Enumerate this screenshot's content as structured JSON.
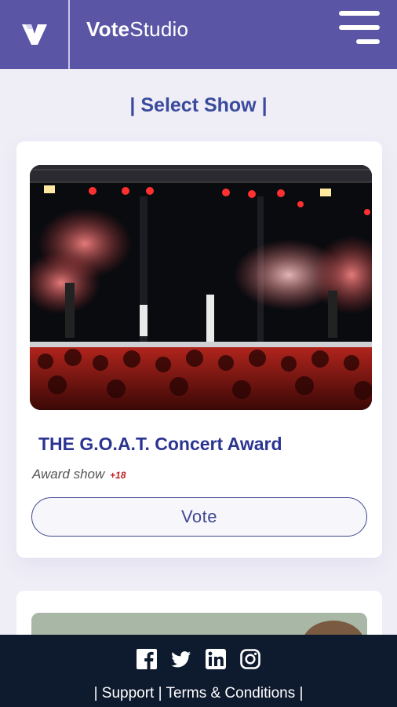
{
  "header": {
    "brand_bold": "Vote",
    "brand_regular": "Studio",
    "logo_icon": "v-logo-icon",
    "menu_icon": "hamburger-menu-icon",
    "color": "#5a56a5"
  },
  "page": {
    "section_title": "| Select Show |"
  },
  "shows": [
    {
      "title": "THE G.O.A.T. Concert Award",
      "category": "Award show",
      "age_rating": "+18",
      "vote_label": "Vote"
    }
  ],
  "footer": {
    "social_icons": [
      "facebook-icon",
      "twitter-icon",
      "linkedin-icon",
      "instagram-icon"
    ],
    "sep1": "|",
    "support": "Support",
    "sep2": "|",
    "terms": "Terms & Conditions",
    "sep3": "|",
    "color": "#0e1a2e"
  }
}
